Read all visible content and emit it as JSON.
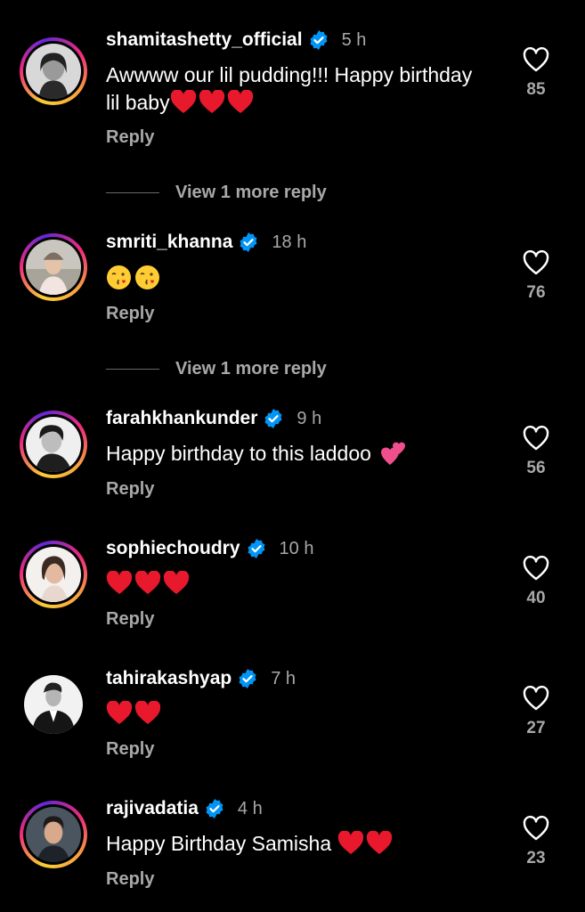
{
  "comments": [
    {
      "username": "shamitashetty_official",
      "time": "5 h",
      "text": "Awwww our lil pudding!!! Happy birthday lil baby",
      "emoji_suffix": [
        "red-heart",
        "red-heart",
        "red-heart"
      ],
      "likes": "85",
      "reply_label": "Reply",
      "view_more": "View 1 more reply",
      "verified": true,
      "story_ring": true
    },
    {
      "username": "smriti_khanna",
      "time": "18 h",
      "text": "",
      "emoji_suffix": [
        "face-blowing-kiss",
        "face-blowing-kiss"
      ],
      "likes": "76",
      "reply_label": "Reply",
      "view_more": "View 1 more reply",
      "verified": true,
      "story_ring": true
    },
    {
      "username": "farahkhankunder",
      "time": "9 h",
      "text": "Happy birthday to this laddoo",
      "emoji_suffix": [
        "two-hearts"
      ],
      "likes": "56",
      "reply_label": "Reply",
      "verified": true,
      "story_ring": true
    },
    {
      "username": "sophiechoudry",
      "time": "10 h",
      "text": "",
      "emoji_suffix": [
        "red-heart",
        "red-heart",
        "red-heart"
      ],
      "likes": "40",
      "reply_label": "Reply",
      "verified": true,
      "story_ring": true
    },
    {
      "username": "tahirakashyap",
      "time": "7 h",
      "text": "",
      "emoji_suffix": [
        "red-heart",
        "red-heart"
      ],
      "likes": "27",
      "reply_label": "Reply",
      "verified": true,
      "story_ring": false
    },
    {
      "username": "rajivadatia",
      "time": "4 h",
      "text": "Happy Birthday Samisha",
      "emoji_suffix": [
        "red-heart",
        "red-heart"
      ],
      "likes": "23",
      "reply_label": "Reply",
      "verified": true,
      "story_ring": true
    }
  ],
  "colors": {
    "background": "#000000",
    "text_primary": "#ffffff",
    "text_secondary": "#a8a8a8",
    "verified_blue": "#0095f6",
    "heart_red": "#e8192c"
  }
}
